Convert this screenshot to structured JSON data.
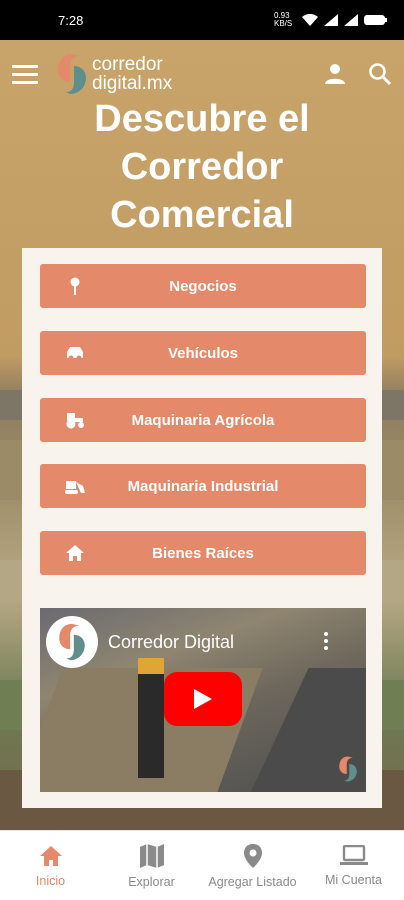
{
  "status_bar": {
    "time": "7:28",
    "speed": "0.93 KB/S"
  },
  "header": {
    "logo_line1": "corredor",
    "logo_line2": "digital.mx"
  },
  "hero": {
    "title_line1": "Descubre el",
    "title_line2": "Corredor",
    "title_line3": "Comercial"
  },
  "categories": [
    {
      "label": "Negocios",
      "icon": "map-pin-icon"
    },
    {
      "label": "Vehículos",
      "icon": "car-icon"
    },
    {
      "label": "Maquinaria Agrícola",
      "icon": "tractor-icon"
    },
    {
      "label": "Maquinaria Industrial",
      "icon": "excavator-icon"
    },
    {
      "label": "Bienes Raíces",
      "icon": "home-icon"
    }
  ],
  "video": {
    "title": "Corredor Digital"
  },
  "bottom_nav": [
    {
      "label": "Inicio",
      "icon": "home-icon",
      "active": true
    },
    {
      "label": "Explorar",
      "icon": "map-icon",
      "active": false
    },
    {
      "label": "Agregar Listado",
      "icon": "location-icon",
      "active": false
    },
    {
      "label": "Mi Cuenta",
      "icon": "laptop-icon",
      "active": false
    }
  ],
  "colors": {
    "accent": "#e4896a",
    "card_bg": "#f8f3ec",
    "youtube_red": "#ff0000"
  }
}
